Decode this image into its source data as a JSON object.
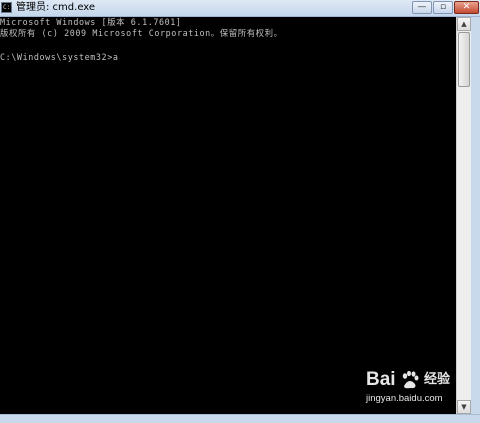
{
  "window": {
    "title": "管理员: cmd.exe",
    "icon_label": "C:\\",
    "minimize_label": "—",
    "maximize_label": "▫",
    "close_label": "✕"
  },
  "console": {
    "lines": [
      "Microsoft Windows [版本 6.1.7601]",
      "版权所有 (c) 2009 Microsoft Corporation。保留所有权利。",
      "C:\\Windows\\system32>a"
    ],
    "text_color": "#c0c0c0",
    "background_color": "#000000"
  },
  "scrollbar": {
    "up_icon": "scroll-up-arrow-icon",
    "down_icon": "scroll-down-arrow-icon",
    "up_glyph": "▲",
    "down_glyph": "▼"
  },
  "watermark": {
    "brand_left": "Bai",
    "brand_right": "经验",
    "url": "jingyan.baidu.com",
    "paw_icon": "baidu-paw-icon"
  }
}
